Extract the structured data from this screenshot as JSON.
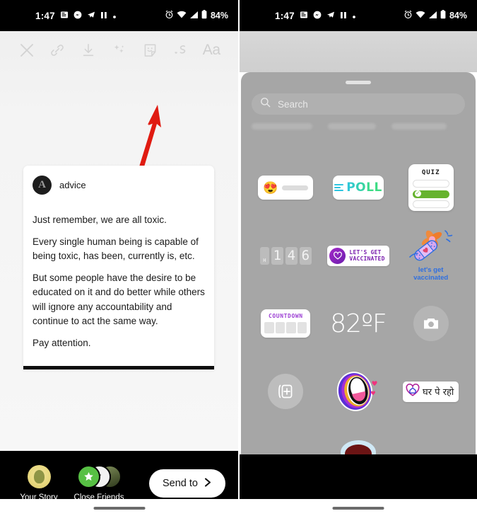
{
  "status_bar": {
    "time": "1:47",
    "left_icons": [
      "news-icon",
      "messenger-icon",
      "telegram-icon",
      "pause-icon",
      "dot-icon"
    ],
    "right_icons": [
      "alarm-icon",
      "wifi-icon",
      "signal-icon",
      "battery-icon"
    ],
    "battery": "84%"
  },
  "left_screen": {
    "toolbar": {
      "close_label": "✕",
      "items": [
        {
          "name": "close-icon",
          "label": "Close"
        },
        {
          "name": "link-icon",
          "label": "Link"
        },
        {
          "name": "download-icon",
          "label": "Save"
        },
        {
          "name": "effects-icon",
          "label": "Effects"
        },
        {
          "name": "sticker-icon",
          "label": "Stickers"
        },
        {
          "name": "draw-icon",
          "label": "Draw"
        },
        {
          "name": "text-icon",
          "label": "Aa"
        }
      ],
      "text_label": "Aa"
    },
    "card": {
      "avatar_letter": "A",
      "username": "advice",
      "paragraphs": [
        "Just remember, we are all toxic.",
        "Every single human being is capable of being toxic, has been, currently is, etc.",
        "But some people have the desire to be educated on it and do better while others will ignore any accountability and continue to act the same way.",
        "Pay attention."
      ]
    },
    "bottom_bar": {
      "your_story_label": "Your Story",
      "close_friends_label": "Close Friends",
      "send_to_label": "Send to",
      "send_to_chevron": "❯"
    }
  },
  "right_screen": {
    "tray": {
      "search_placeholder": "Search",
      "grabber": "drag-handle"
    },
    "stickers": [
      [
        {
          "name": "emoji-slider-sticker",
          "emoji": "😍",
          "label": "Emoji Slider"
        },
        {
          "name": "poll-sticker",
          "label": "POLL"
        },
        {
          "name": "quiz-sticker",
          "label": "QUIZ"
        }
      ],
      [
        {
          "name": "countdown-number-sticker",
          "digits": [
            "1",
            "4",
            "6"
          ],
          "unit": "H"
        },
        {
          "name": "lets-get-vaccinated-pill-sticker",
          "line1": "LET'S GET",
          "line2": "VACCINATED"
        },
        {
          "name": "lets-get-vaccinated-art-sticker",
          "line1": "let's get",
          "line2": "vaccinated"
        }
      ],
      [
        {
          "name": "countdown-sticker",
          "label": "COUNTDOWN"
        },
        {
          "name": "temperature-sticker",
          "label": "82ºF"
        },
        {
          "name": "camera-sticker",
          "label": "Camera"
        }
      ],
      [
        {
          "name": "add-yours-sticker",
          "label": "Add Yours"
        },
        {
          "name": "mouth-sticker",
          "label": "Mouth"
        },
        {
          "name": "ghar-pe-raho-sticker",
          "label": "घर पे रहो"
        }
      ]
    ]
  },
  "annotations": {
    "arrow_color": "#e01b11",
    "left_arrow_target": "sticker-icon",
    "right_arrow_target": "add-yours-sticker"
  }
}
